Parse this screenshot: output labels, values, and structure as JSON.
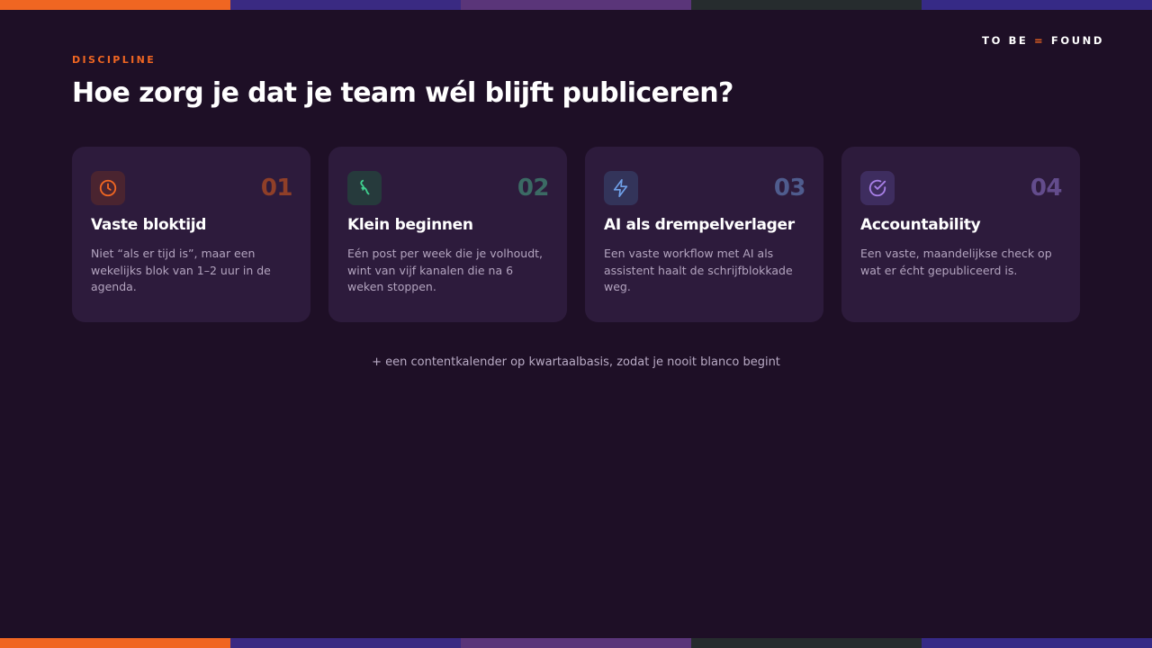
{
  "colors": {
    "background": "#1e0f26",
    "card": "#2d1b3c",
    "accent": "#f06622",
    "stripe": [
      "#f06622",
      "#3a2a82",
      "#5a3579",
      "#262c2e",
      "#362a86"
    ]
  },
  "brand": {
    "part1": "TO BE",
    "separator": "=",
    "part2": "FOUND"
  },
  "eyebrow": "DISCIPLINE",
  "title": "Hoe zorg je dat je team wél blijft publiceren?",
  "cards": [
    {
      "icon": "clock-icon",
      "number": "01",
      "title": "Vaste bloktijd",
      "text": "Niet “als er tijd is”, maar een wekelijks blok van 1–2 uur in de agenda.",
      "icon_color": "#f06622",
      "icon_bg": "#4a2430",
      "number_color": "#8f3f28"
    },
    {
      "icon": "sprout-icon",
      "number": "02",
      "title": "Klein beginnen",
      "text": "Eén post per week die je volhoudt, wint van vijf kanalen die na 6 weken stoppen.",
      "icon_color": "#3fcf8e",
      "icon_bg": "#263a3c",
      "number_color": "#3b6a64"
    },
    {
      "icon": "lightning-icon",
      "number": "03",
      "title": "AI als drempelverlager",
      "text": "Een vaste workflow met AI als assistent haalt de schrijfblokkade weg.",
      "icon_color": "#6fa0e8",
      "icon_bg": "#33345a",
      "number_color": "#4f5c8e"
    },
    {
      "icon": "check-circle-icon",
      "number": "04",
      "title": "Accountability",
      "text": "Een vaste, maandelijkse check op wat er écht gepubliceerd is.",
      "icon_color": "#a77fe6",
      "icon_bg": "#3e2d5f",
      "number_color": "#634c8c"
    }
  ],
  "footnote": "+ een contentkalender op kwartaalbasis, zodat je nooit blanco begint"
}
